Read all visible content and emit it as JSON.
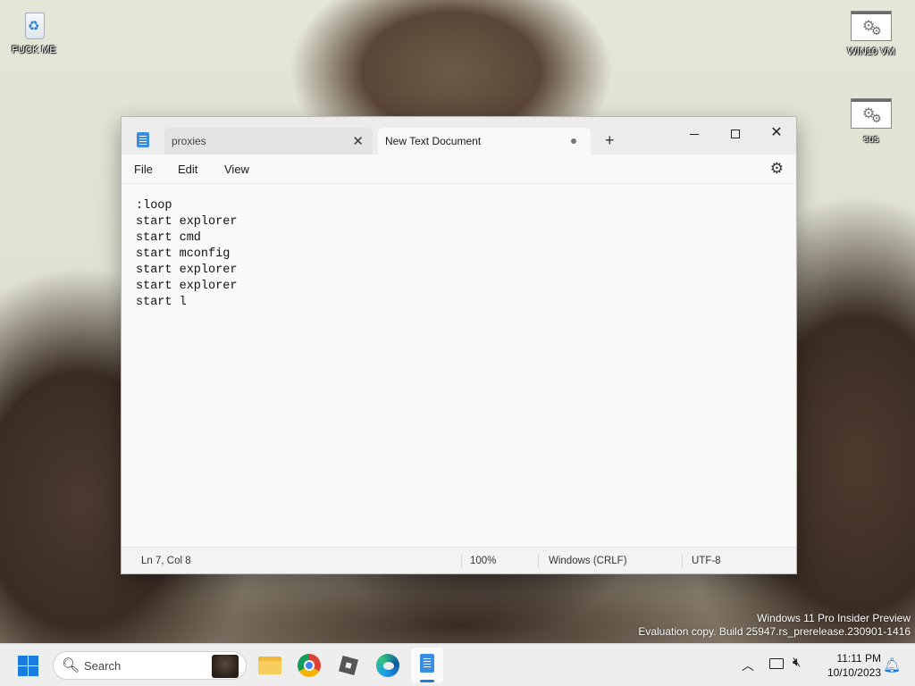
{
  "desktop": {
    "icons": [
      {
        "label": "FUCK ME",
        "icon": "recycle-bin-icon"
      },
      {
        "label": "WIN10 VM",
        "icon": "shortcut-gear-icon"
      },
      {
        "label": "sus",
        "icon": "shortcut-gear-icon"
      }
    ],
    "watermark": {
      "line1": "Windows 11 Pro Insider Preview",
      "line2": "Evaluation copy. Build 25947.rs_prerelease.230901-1416"
    }
  },
  "notepad": {
    "tabs": [
      {
        "label": "proxies",
        "active": false
      },
      {
        "label": "New Text Document",
        "active": true,
        "unsaved": true
      }
    ],
    "menu": [
      "File",
      "Edit",
      "View"
    ],
    "content_lines": [
      ":loop",
      "start explorer",
      "start cmd",
      "start mconfig",
      "start explorer",
      "start explorer",
      "start l"
    ],
    "status": {
      "position": "Ln 7, Col 8",
      "zoom": "100%",
      "line_endings": "Windows (CRLF)",
      "encoding": "UTF-8"
    }
  },
  "taskbar": {
    "search_placeholder": "Search",
    "apps": [
      "file-explorer",
      "chrome",
      "roblox",
      "edge",
      "notepad"
    ],
    "clock": {
      "time": "11:11 PM",
      "date": "10/10/2023"
    }
  },
  "colors": {
    "accent": "#1a7ce0",
    "notepad_icon": "#3a8de0",
    "taskbar_bg": "#eeeeee"
  }
}
